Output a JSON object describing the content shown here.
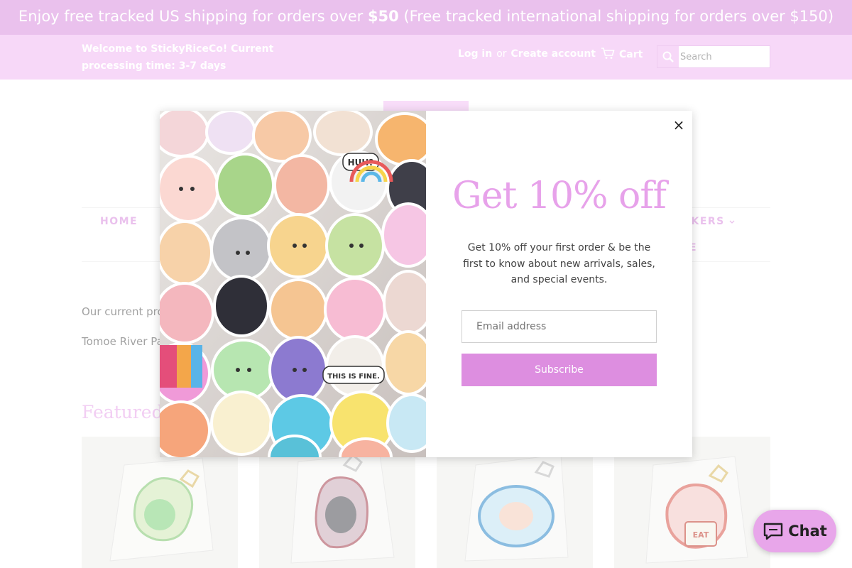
{
  "announcement": {
    "part1": "Enjoy free tracked US shipping for orders over",
    "amount": "$50",
    "part2": "(Free tracked international shipping for orders over $150)"
  },
  "header": {
    "welcome": "Welcome to StickyRiceCo! Current processing time: 3-7 days",
    "login": "Log in",
    "or": "or",
    "create_account": "Create account",
    "cart": "Cart",
    "search_placeholder": "Search"
  },
  "nav": {
    "home": "HOME",
    "stickers": "ICKERS",
    "more": "E"
  },
  "main": {
    "para1": "Our current pro",
    "para2": "Tomoe River Pa",
    "featured": "Featured"
  },
  "popup": {
    "title": "Get 10% off",
    "description": "Get 10% off your first order & be the first to know about new arrivals, sales, and special events.",
    "email_placeholder": "Email address",
    "subscribe": "Subscribe",
    "close": "×",
    "sticker_texts": [
      "HUH?",
      "THIS IS FINE.",
      "EAT"
    ]
  },
  "chat": {
    "label": "Chat"
  },
  "colors": {
    "accent": "#d98fdf",
    "header_bg": "#f0b8f2",
    "title_pink": "#e7a2ea"
  }
}
